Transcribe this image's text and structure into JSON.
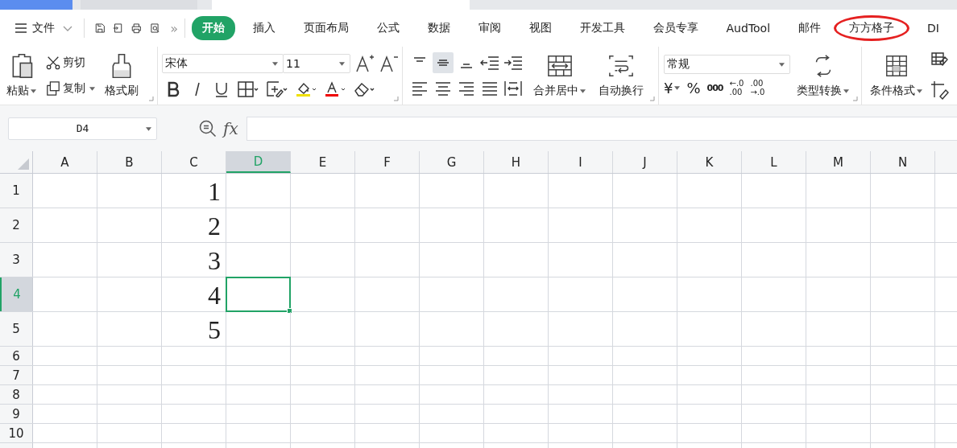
{
  "menu": {
    "file_label": "文件",
    "more": "»",
    "tabs": [
      {
        "label": "开始",
        "selected": true,
        "highlighted": false
      },
      {
        "label": "插入",
        "selected": false,
        "highlighted": false
      },
      {
        "label": "页面布局",
        "selected": false,
        "highlighted": false
      },
      {
        "label": "公式",
        "selected": false,
        "highlighted": false
      },
      {
        "label": "数据",
        "selected": false,
        "highlighted": false
      },
      {
        "label": "审阅",
        "selected": false,
        "highlighted": false
      },
      {
        "label": "视图",
        "selected": false,
        "highlighted": false
      },
      {
        "label": "开发工具",
        "selected": false,
        "highlighted": false
      },
      {
        "label": "会员专享",
        "selected": false,
        "highlighted": false
      },
      {
        "label": "AudTool",
        "selected": false,
        "highlighted": false
      },
      {
        "label": "邮件",
        "selected": false,
        "highlighted": false
      },
      {
        "label": "方方格子",
        "selected": false,
        "highlighted": true
      },
      {
        "label": "DI",
        "selected": false,
        "highlighted": false
      }
    ]
  },
  "ribbon": {
    "clipboard": {
      "paste": "粘贴",
      "cut": "剪切",
      "copy": "复制",
      "format_painter": "格式刷"
    },
    "font": {
      "name": "宋体",
      "size": "11"
    },
    "vertical_align": [
      {
        "kind": "top",
        "selected": false
      },
      {
        "kind": "middle",
        "selected": true
      },
      {
        "kind": "bottom",
        "selected": false
      }
    ],
    "alignment": {
      "merge": "合并居中",
      "wrap": "自动换行"
    },
    "number": {
      "format": "常规",
      "currency": "¥",
      "percent": "%",
      "thousands": "000",
      "increase_decimal": [
        "←.0",
        ".00"
      ],
      "decrease_decimal": [
        ".00",
        "→.0"
      ],
      "convert": "类型转换"
    },
    "styles": {
      "conditional": "条件格式"
    }
  },
  "formula_bar": {
    "name_box": "D4",
    "fx": "fx"
  },
  "grid": {
    "columns": [
      {
        "label": "A",
        "selected": false
      },
      {
        "label": "B",
        "selected": false
      },
      {
        "label": "C",
        "selected": false
      },
      {
        "label": "D",
        "selected": true
      },
      {
        "label": "E",
        "selected": false
      },
      {
        "label": "F",
        "selected": false
      },
      {
        "label": "G",
        "selected": false
      },
      {
        "label": "H",
        "selected": false
      },
      {
        "label": "I",
        "selected": false
      },
      {
        "label": "J",
        "selected": false
      },
      {
        "label": "K",
        "selected": false
      },
      {
        "label": "L",
        "selected": false
      },
      {
        "label": "M",
        "selected": false
      },
      {
        "label": "N",
        "selected": false
      }
    ],
    "rows": [
      {
        "label": "1",
        "selected": false,
        "kind": "tall",
        "column_c": "1"
      },
      {
        "label": "2",
        "selected": false,
        "kind": "tall",
        "column_c": "2"
      },
      {
        "label": "3",
        "selected": false,
        "kind": "tall",
        "column_c": "3"
      },
      {
        "label": "4",
        "selected": true,
        "kind": "tall",
        "column_c": "4"
      },
      {
        "label": "5",
        "selected": false,
        "kind": "tall",
        "column_c": "5"
      },
      {
        "label": "6",
        "selected": false,
        "kind": "normal"
      },
      {
        "label": "7",
        "selected": false,
        "kind": "normal"
      },
      {
        "label": "8",
        "selected": false,
        "kind": "normal"
      },
      {
        "label": "9",
        "selected": false,
        "kind": "normal"
      },
      {
        "label": "10",
        "selected": false,
        "kind": "normal"
      }
    ]
  }
}
